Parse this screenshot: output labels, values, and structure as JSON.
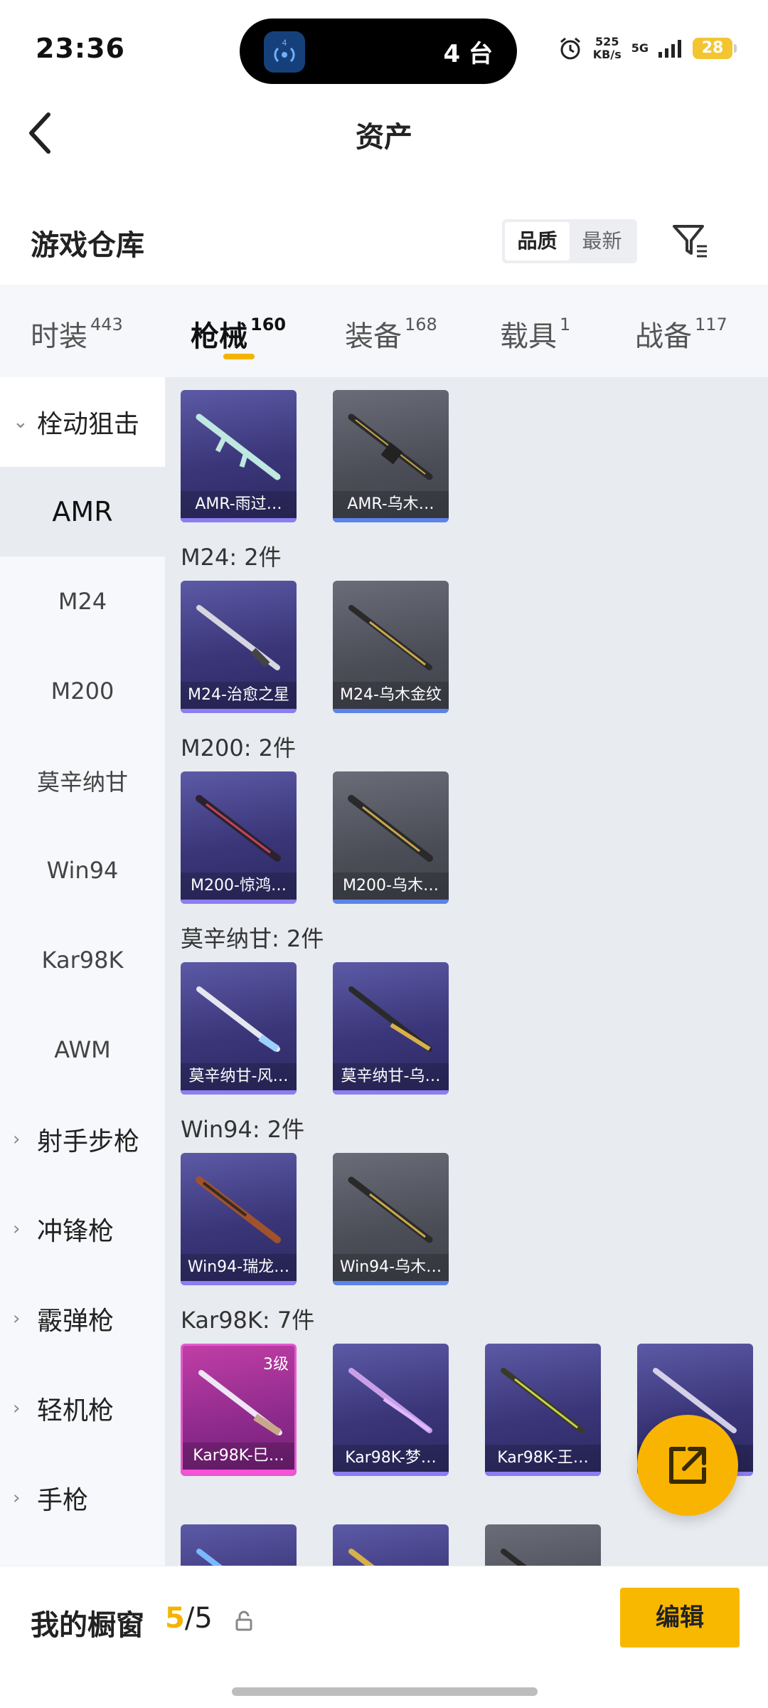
{
  "status": {
    "time": "23:36",
    "island_app_badge": "4",
    "island_text": "4 台",
    "speed_value": "525",
    "speed_unit": "KB/s",
    "network": "5G",
    "battery": "28"
  },
  "nav": {
    "title": "资产",
    "back_icon": "chevron-left-icon"
  },
  "section": {
    "title": "游戏仓库",
    "sort_options": [
      "品质",
      "最新"
    ],
    "sort_selected": "品质",
    "filter_icon": "filter-icon"
  },
  "tabs": [
    {
      "label": "时装",
      "count": "443"
    },
    {
      "label": "枪械",
      "count": "160"
    },
    {
      "label": "装备",
      "count": "168"
    },
    {
      "label": "载具",
      "count": "1"
    },
    {
      "label": "战备",
      "count": "117"
    }
  ],
  "active_tab": "枪械",
  "sidebar": {
    "open_category": "栓动狙击",
    "sub_items": [
      "AMR",
      "M24",
      "M200",
      "莫辛纳甘",
      "Win94",
      "Kar98K",
      "AWM"
    ],
    "active_sub": "AMR",
    "categories": [
      "射手步枪",
      "冲锋枪",
      "霰弹枪",
      "轻机枪",
      "手枪"
    ]
  },
  "groups": [
    {
      "label": "",
      "items": [
        {
          "name": "AMR-雨过…",
          "rarity": "purple"
        },
        {
          "name": "AMR-乌木…",
          "rarity": "gray"
        }
      ]
    },
    {
      "label": "M24: 2件",
      "items": [
        {
          "name": "M24-治愈之星",
          "rarity": "purple"
        },
        {
          "name": "M24-乌木金纹",
          "rarity": "gray"
        }
      ]
    },
    {
      "label": "M200: 2件",
      "items": [
        {
          "name": "M200-惊鸿…",
          "rarity": "purple"
        },
        {
          "name": "M200-乌木…",
          "rarity": "gray"
        }
      ]
    },
    {
      "label": "莫辛纳甘: 2件",
      "items": [
        {
          "name": "莫辛纳甘-风…",
          "rarity": "purple"
        },
        {
          "name": "莫辛纳甘-乌…",
          "rarity": "purple"
        }
      ]
    },
    {
      "label": "Win94: 2件",
      "items": [
        {
          "name": "Win94-瑞龙…",
          "rarity": "purple"
        },
        {
          "name": "Win94-乌木…",
          "rarity": "gray"
        }
      ]
    },
    {
      "label": "Kar98K: 7件",
      "items": [
        {
          "name": "Kar98K-巳…",
          "rarity": "pink",
          "level": "3级"
        },
        {
          "name": "Kar98K-梦…",
          "rarity": "purple"
        },
        {
          "name": "Kar98K-王…",
          "rarity": "purple"
        },
        {
          "name": "",
          "rarity": "purple"
        }
      ]
    }
  ],
  "fab_icon": "share-external-icon",
  "bottom": {
    "title": "我的橱窗",
    "count_current": "5",
    "count_total": "/5",
    "lock_icon": "lock-icon",
    "edit_label": "编辑"
  },
  "colors": {
    "accent": "#f5b300",
    "purple_card": "#3a3578",
    "gray_card": "#4a4c56",
    "pink_card": "#8d2a8b",
    "content_bg": "#e8ebf0"
  }
}
